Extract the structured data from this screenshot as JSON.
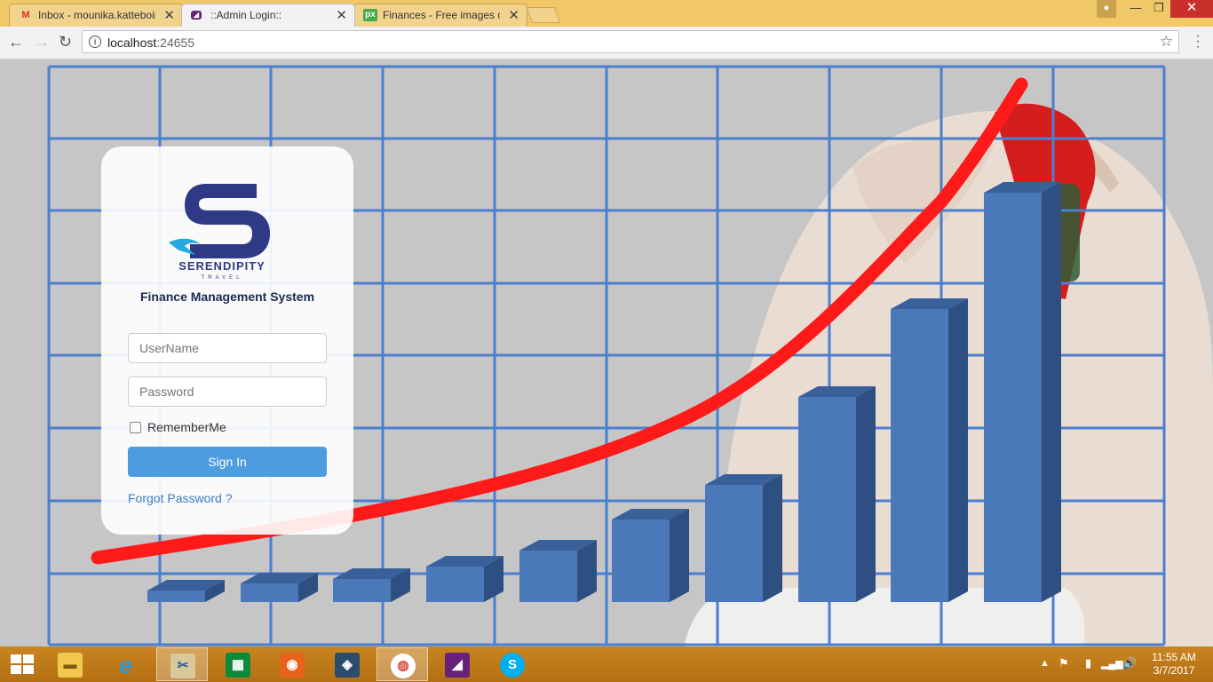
{
  "browser": {
    "tabs": [
      {
        "title": "Inbox - mounika.katteboina",
        "favicon": "gmail-icon",
        "active": false
      },
      {
        "title": "::Admin Login::",
        "favicon": "visual-studio-icon",
        "active": true
      },
      {
        "title": "Finances - Free images o",
        "favicon": "pixabay-icon",
        "active": false
      }
    ],
    "tab_close_glyph": "✕",
    "url_host": "localhost",
    "url_port": ":24655"
  },
  "login": {
    "brand_name": "SERENDIPITY",
    "brand_sub": "TRAVEL",
    "system_title": "Finance Management System",
    "username_placeholder": "UserName",
    "password_placeholder": "Password",
    "remember_label": "RememberMe",
    "signin_label": "Sign In",
    "forgot_label": "Forgot Password ?"
  },
  "background": {
    "description_icon": "finance-growth-chart-image",
    "bar_color": "#4a78b8",
    "curve_color": "#ff1a1a",
    "grid_color": "#4a7fd0"
  },
  "taskbar": {
    "apps": [
      {
        "name": "file-explorer-icon",
        "active": false
      },
      {
        "name": "internet-explorer-icon",
        "active": false
      },
      {
        "name": "snipping-tool-icon",
        "active": true
      },
      {
        "name": "windows-store-icon",
        "active": false
      },
      {
        "name": "firefox-icon",
        "active": false
      },
      {
        "name": "mysql-workbench-icon",
        "active": false
      },
      {
        "name": "chrome-icon",
        "active": true
      },
      {
        "name": "visual-studio-icon",
        "active": false
      },
      {
        "name": "skype-icon",
        "active": false
      }
    ],
    "time": "11:55 AM",
    "date": "3/7/2017"
  }
}
